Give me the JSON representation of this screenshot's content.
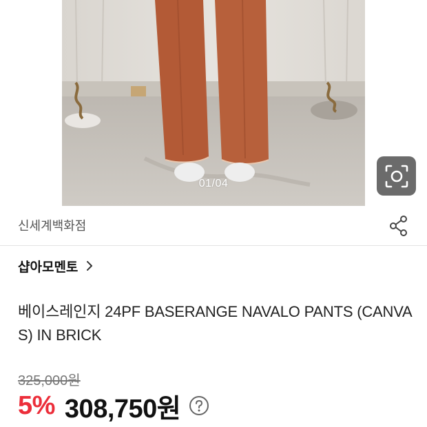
{
  "gallery": {
    "counter": "01/04",
    "image_alt": "Brick colored wide-leg pants worn with white socks"
  },
  "store": {
    "name": "신세계백화점"
  },
  "brand": {
    "name": "샵아모멘토"
  },
  "product": {
    "title": "베이스레인지 24PF BASERANGE NAVALO PANTS (CANVAS) IN BRICK"
  },
  "price": {
    "original": "325,000원",
    "discount": "5%",
    "sale": "308,750원"
  },
  "icons": {
    "lens": "camera-search-icon",
    "share": "share-icon",
    "brand_chevron": "chevron-right-icon",
    "help": "question-circle-icon"
  },
  "colors": {
    "discount": "#ec2e3a",
    "pants": "#b35a36",
    "lens_button": "#6b6b6b"
  }
}
